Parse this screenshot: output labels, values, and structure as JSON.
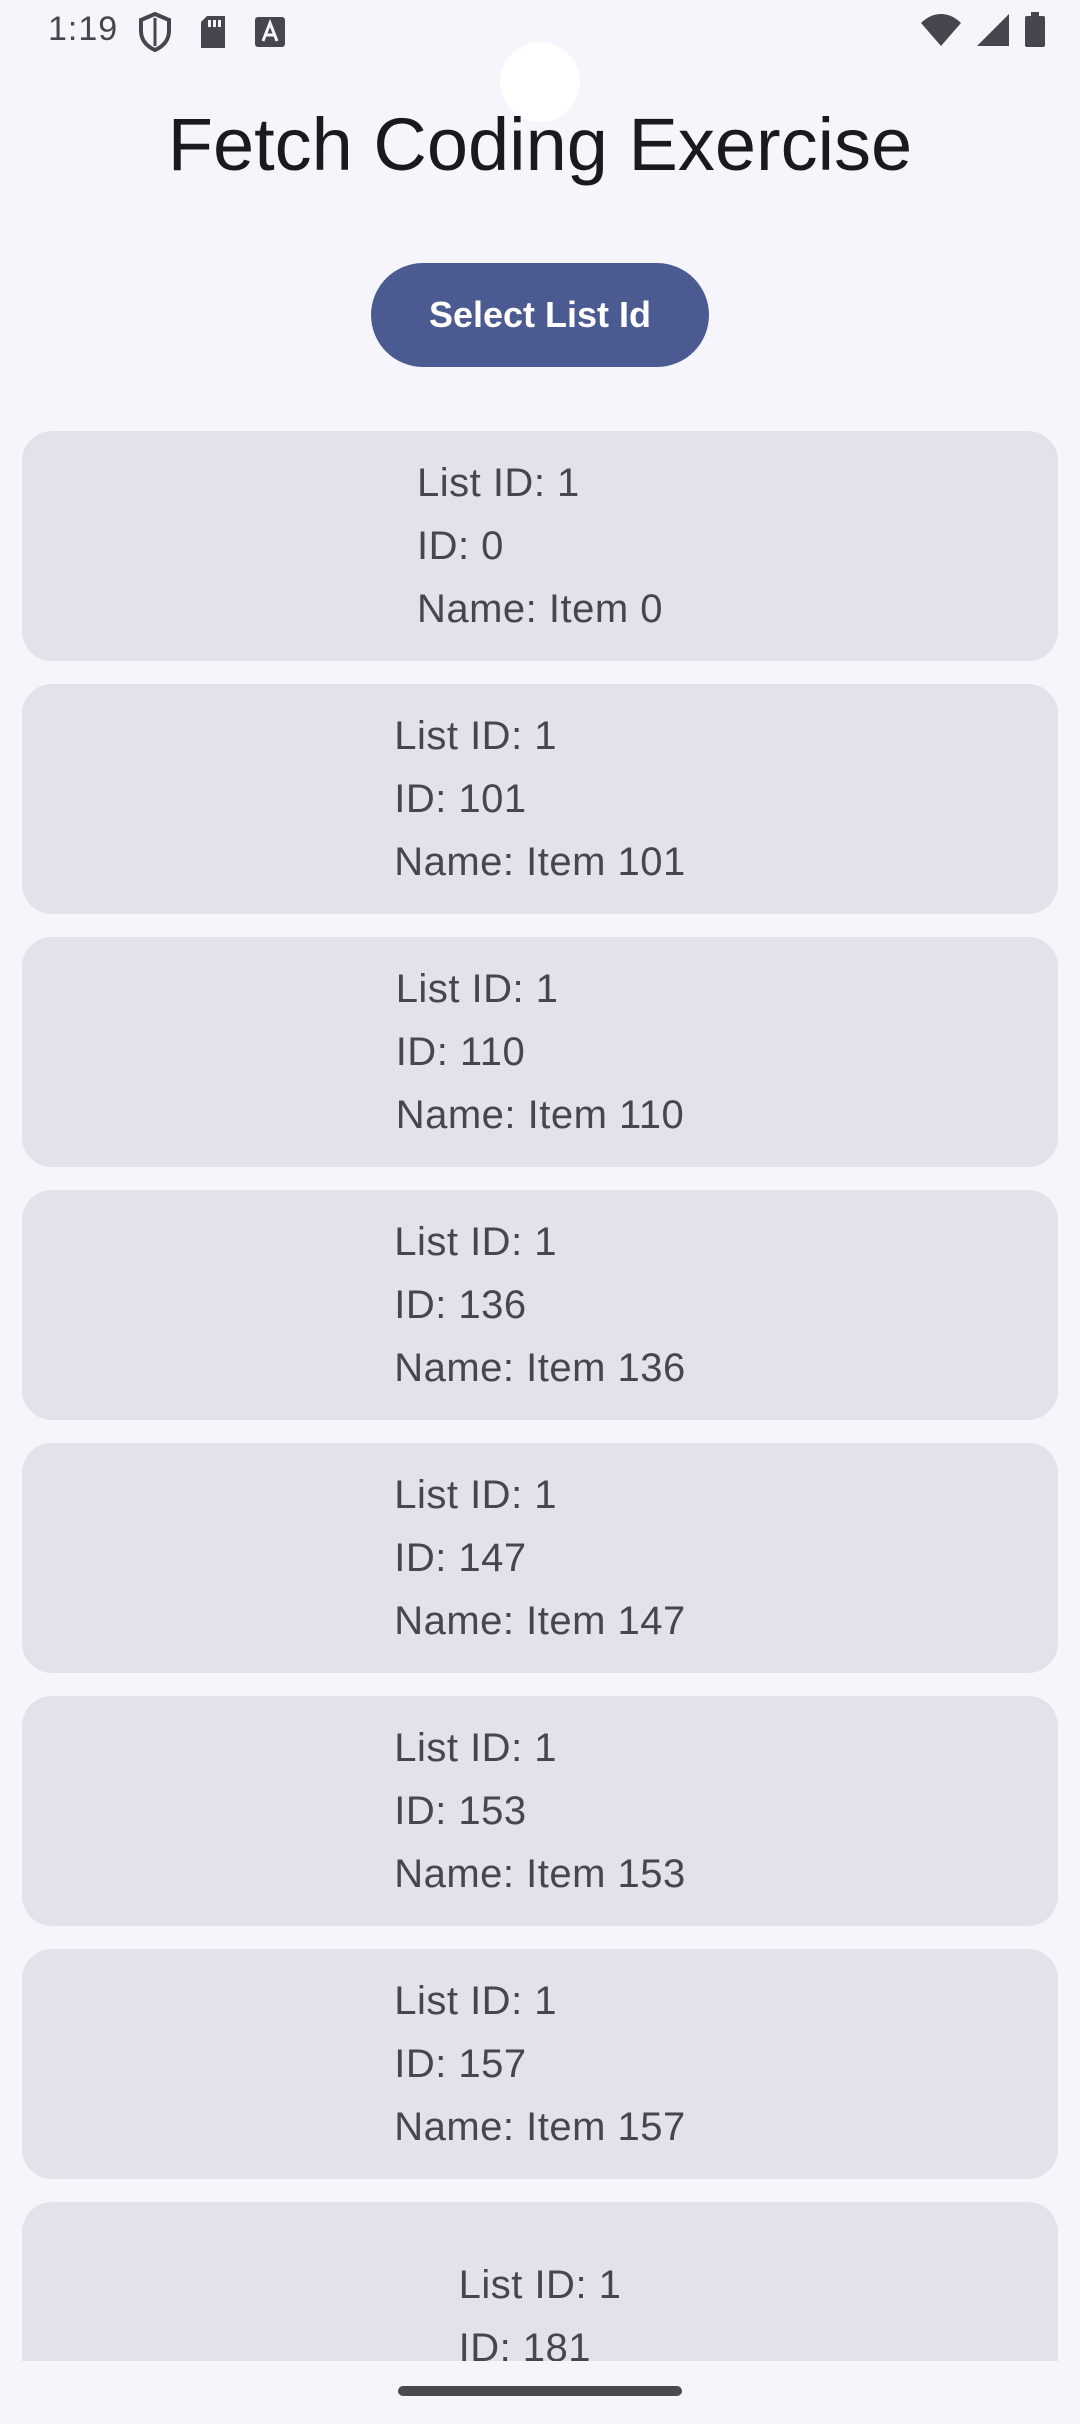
{
  "status_bar": {
    "time": "1:19",
    "left_icons": [
      "shield-icon",
      "sd-card-icon",
      "font-icon"
    ],
    "right_icons": [
      "wifi-icon",
      "signal-icon",
      "battery-icon"
    ]
  },
  "header": {
    "title": "Fetch Coding Exercise"
  },
  "actions": {
    "select_label": "Select List Id"
  },
  "items": [
    {
      "list_id": "List ID: 1",
      "id": "ID: 0",
      "name": "Name: Item 0"
    },
    {
      "list_id": "List ID: 1",
      "id": "ID: 101",
      "name": "Name: Item 101"
    },
    {
      "list_id": "List ID: 1",
      "id": "ID: 110",
      "name": "Name: Item 110"
    },
    {
      "list_id": "List ID: 1",
      "id": "ID: 136",
      "name": "Name: Item 136"
    },
    {
      "list_id": "List ID: 1",
      "id": "ID: 147",
      "name": "Name: Item 147"
    },
    {
      "list_id": "List ID: 1",
      "id": "ID: 153",
      "name": "Name: Item 153"
    },
    {
      "list_id": "List ID: 1",
      "id": "ID: 157",
      "name": "Name: Item 157"
    },
    {
      "list_id": "List ID: 1",
      "id": "ID: 181",
      "name": ""
    }
  ],
  "colors": {
    "background": "#f6f5fb",
    "button": "#4b5b92",
    "card": "#e2e2ea",
    "card_text": "#45464f"
  }
}
